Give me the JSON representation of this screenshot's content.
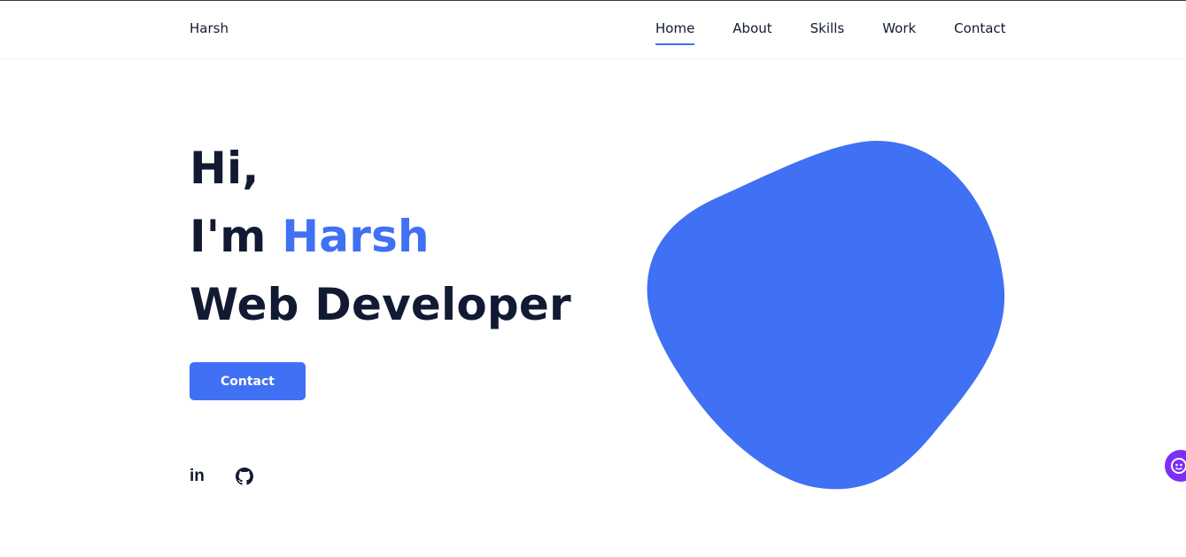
{
  "brand": "Harsh",
  "nav": {
    "items": [
      "Home",
      "About",
      "Skills",
      "Work",
      "Contact"
    ],
    "active": "Home"
  },
  "hero": {
    "line1": "Hi,",
    "line2_prefix": "I'm ",
    "name": "Harsh",
    "line3": "Web Developer"
  },
  "cta_label": "Contact",
  "social": {
    "linkedin_text": "in",
    "icons": [
      "linkedin-icon",
      "github-icon"
    ]
  },
  "colors": {
    "accent": "#4070f4",
    "text": "#121a33",
    "helper_badge": "#7b2ff7"
  }
}
